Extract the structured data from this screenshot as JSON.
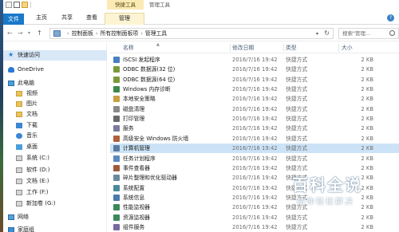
{
  "window": {
    "title": "管理工具",
    "context_group": "快捷工具"
  },
  "ribbon": {
    "tabs": [
      "文件",
      "主页",
      "共享",
      "查看",
      "管理"
    ]
  },
  "address": {
    "breadcrumbs": [
      "控制面板",
      "所有控制面板项",
      "管理工具"
    ],
    "search_placeholder": "搜索\"管理...",
    "colors": {
      "file_tab": "#1979ca",
      "context_tab": "#fdf4d4",
      "selection": "#cce3f7"
    }
  },
  "nav": {
    "items": [
      {
        "label": "快速访问",
        "icon": "star-icon"
      },
      {
        "label": "OneDrive",
        "icon": "cloud-icon"
      },
      {
        "label": "此电脑",
        "icon": "pc-icon"
      },
      {
        "label": "视频",
        "icon": "folder-icon"
      },
      {
        "label": "图片",
        "icon": "folder-icon"
      },
      {
        "label": "文档",
        "icon": "folder-icon"
      },
      {
        "label": "下载",
        "icon": "download-icon"
      },
      {
        "label": "音乐",
        "icon": "music-icon"
      },
      {
        "label": "桌面",
        "icon": "desktop-icon"
      },
      {
        "label": "系统 (C:)",
        "icon": "drive-icon"
      },
      {
        "label": "软件 (D:)",
        "icon": "drive-icon"
      },
      {
        "label": "文档 (E:)",
        "icon": "drive-icon"
      },
      {
        "label": "工作 (F:)",
        "icon": "drive-icon"
      },
      {
        "label": "新加卷 (G:)",
        "icon": "drive-icon"
      },
      {
        "label": "网络",
        "icon": "network-icon"
      },
      {
        "label": "家庭组",
        "icon": "homegroup-icon"
      }
    ]
  },
  "columns": {
    "name": "名称",
    "date": "修改日期",
    "type": "类型",
    "size": "大小"
  },
  "files": [
    {
      "name": "iSCSI 发起程序",
      "date": "2016/7/16 19:42",
      "type": "快捷方式",
      "size": "2 KB",
      "icon": "iscsi-icon",
      "color": "#4a7fc1"
    },
    {
      "name": "ODBC 数据源(32 位)",
      "date": "2016/7/16 19:42",
      "type": "快捷方式",
      "size": "2 KB",
      "icon": "odbc-icon",
      "color": "#7a9a3a"
    },
    {
      "name": "ODBC 数据源(64 位)",
      "date": "2016/7/16 19:42",
      "type": "快捷方式",
      "size": "2 KB",
      "icon": "odbc-icon",
      "color": "#7a9a3a"
    },
    {
      "name": "Windows 内存诊断",
      "date": "2016/7/16 19:42",
      "type": "快捷方式",
      "size": "2 KB",
      "icon": "memory-icon",
      "color": "#3b8a4a"
    },
    {
      "name": "本地安全策略",
      "date": "2016/7/16 19:42",
      "type": "快捷方式",
      "size": "2 KB",
      "icon": "security-policy-icon",
      "color": "#c8a040"
    },
    {
      "name": "磁盘清理",
      "date": "2016/7/16 19:42",
      "type": "快捷方式",
      "size": "2 KB",
      "icon": "disk-cleanup-icon",
      "color": "#8a8a8a"
    },
    {
      "name": "打印管理",
      "date": "2016/7/16 19:42",
      "type": "快捷方式",
      "size": "2 KB",
      "icon": "printer-icon",
      "color": "#6a6a6a"
    },
    {
      "name": "服务",
      "date": "2016/7/16 19:42",
      "type": "快捷方式",
      "size": "2 KB",
      "icon": "services-icon",
      "color": "#7a7a9a"
    },
    {
      "name": "高级安全 Windows 防火墙",
      "date": "2016/7/16 19:42",
      "type": "快捷方式",
      "size": "2 KB",
      "icon": "firewall-icon",
      "color": "#b0603a"
    },
    {
      "name": "计算机管理",
      "date": "2016/7/16 19:42",
      "type": "快捷方式",
      "size": "2 KB",
      "icon": "computer-management-icon",
      "color": "#5a7aa0"
    },
    {
      "name": "任务计划程序",
      "date": "2016/7/16 19:42",
      "type": "快捷方式",
      "size": "2 KB",
      "icon": "task-scheduler-icon",
      "color": "#5a8ac0"
    },
    {
      "name": "事件查看器",
      "date": "2016/7/16 19:42",
      "type": "快捷方式",
      "size": "2 KB",
      "icon": "event-viewer-icon",
      "color": "#a05a3a"
    },
    {
      "name": "碎片整理和优化驱动器",
      "date": "2016/7/16 19:42",
      "type": "快捷方式",
      "size": "2 KB",
      "icon": "defrag-icon",
      "color": "#6a8aa0"
    },
    {
      "name": "系统配置",
      "date": "2016/7/16 19:42",
      "type": "快捷方式",
      "size": "2 KB",
      "icon": "system-config-icon",
      "color": "#4a8a9a"
    },
    {
      "name": "系统信息",
      "date": "2016/7/16 19:42",
      "type": "快捷方式",
      "size": "2 KB",
      "icon": "system-info-icon",
      "color": "#4a7ab0"
    },
    {
      "name": "性能监视器",
      "date": "2016/7/16 19:42",
      "type": "快捷方式",
      "size": "2 KB",
      "icon": "performance-monitor-icon",
      "color": "#3a8a5a"
    },
    {
      "name": "资源监视器",
      "date": "2016/7/16 19:42",
      "type": "快捷方式",
      "size": "2 KB",
      "icon": "resource-monitor-icon",
      "color": "#3a8a5a"
    },
    {
      "name": "组件服务",
      "date": "2016/7/16 19:42",
      "type": "快捷方式",
      "size": "2 KB",
      "icon": "component-services-icon",
      "color": "#7a6aa0"
    }
  ],
  "watermark": {
    "title": "百科全说",
    "subtitle": "助你轻松解决"
  }
}
